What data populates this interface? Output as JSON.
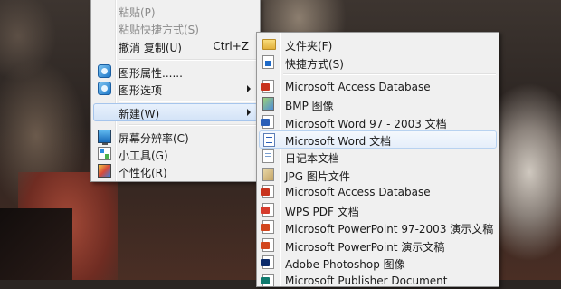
{
  "context_menu": {
    "items": [
      {
        "label": "粘贴(P)",
        "disabled": true
      },
      {
        "label": "粘贴快捷方式(S)",
        "disabled": true
      },
      {
        "label": "撤消 复制(U)",
        "shortcut": "Ctrl+Z"
      },
      {
        "label": "图形属性......",
        "icon": "graphics-properties-icon"
      },
      {
        "label": "图形选项",
        "icon": "graphics-options-icon",
        "has_submenu": true
      },
      {
        "label": "新建(W)",
        "has_submenu": true,
        "highlighted": true
      },
      {
        "label": "屏幕分辨率(C)",
        "icon": "screen-resolution-icon"
      },
      {
        "label": "小工具(G)",
        "icon": "gadgets-icon"
      },
      {
        "label": "个性化(R)",
        "icon": "personalize-icon"
      }
    ]
  },
  "new_submenu": {
    "items": [
      {
        "label": "文件夹(F)",
        "icon": "folder-icon"
      },
      {
        "label": "快捷方式(S)",
        "icon": "shortcut-icon"
      },
      {
        "label": "Microsoft Access Database",
        "icon": "access-database-icon"
      },
      {
        "label": "BMP 图像",
        "icon": "bmp-image-icon"
      },
      {
        "label": "Microsoft Word 97 - 2003 文档",
        "icon": "word-97-document-icon"
      },
      {
        "label": "Microsoft Word 文档",
        "icon": "word-document-icon",
        "highlighted": true
      },
      {
        "label": "日记本文档",
        "icon": "journal-document-icon"
      },
      {
        "label": "JPG 图片文件",
        "icon": "jpg-image-icon"
      },
      {
        "label": "Microsoft Access Database",
        "icon": "access-database-icon"
      },
      {
        "label": "WPS PDF 文档",
        "icon": "wps-pdf-icon"
      },
      {
        "label": "Microsoft PowerPoint 97-2003 演示文稿",
        "icon": "powerpoint-97-icon"
      },
      {
        "label": "Microsoft PowerPoint 演示文稿",
        "icon": "powerpoint-icon"
      },
      {
        "label": "Adobe Photoshop 图像",
        "icon": "photoshop-image-icon"
      },
      {
        "label": "Microsoft Publisher Document",
        "icon": "publisher-document-icon"
      }
    ]
  }
}
